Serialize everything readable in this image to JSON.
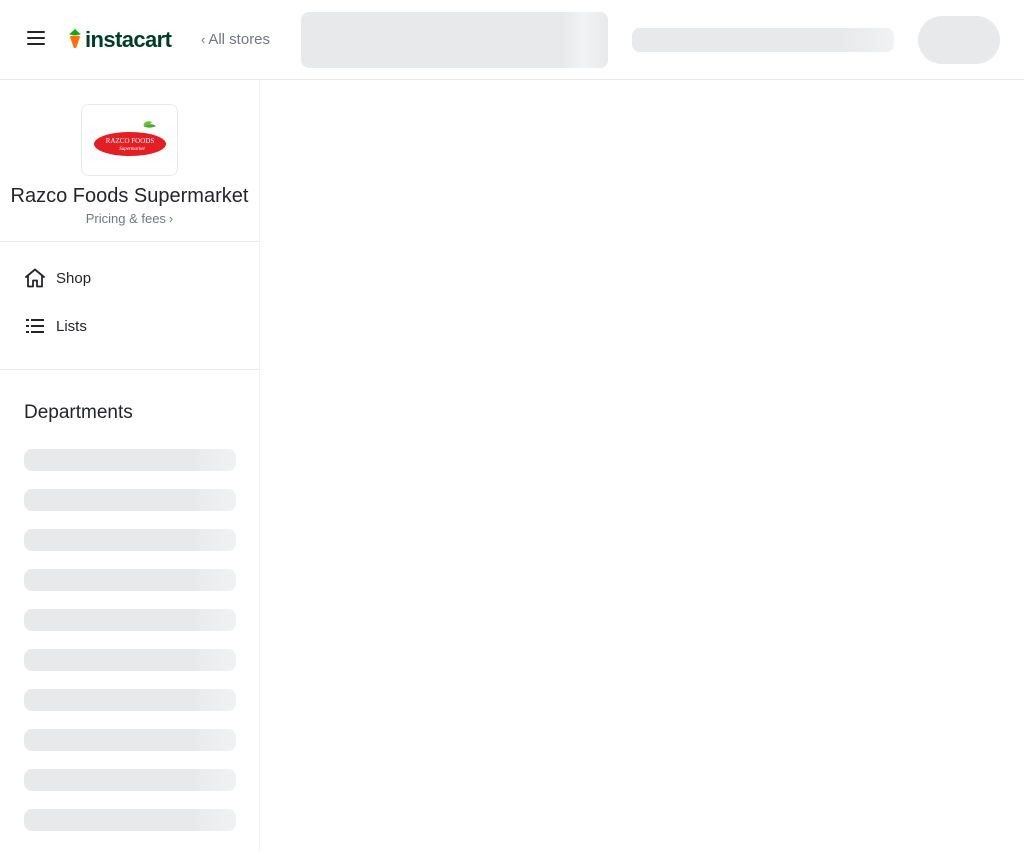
{
  "header": {
    "brand": "instacart",
    "all_stores": "All stores",
    "all_stores_chevron": "‹"
  },
  "store": {
    "name": "Razco Foods Supermarket",
    "pricing_link": "Pricing & fees",
    "pricing_chevron": "›",
    "logo_text_main": "RAZCO FOODS",
    "logo_text_sub": "Supermarket"
  },
  "nav": {
    "items": [
      {
        "label": "Shop",
        "icon": "home-icon"
      },
      {
        "label": "Lists",
        "icon": "list-icon"
      }
    ]
  },
  "departments": {
    "title": "Departments",
    "loading_rows": 10
  },
  "colors": {
    "brand_green": "#003d29",
    "carrot_orange": "#ff7009",
    "carrot_leaf": "#0aad0a",
    "skeleton": "#e8e9eb",
    "logo_red": "#e31e24"
  }
}
